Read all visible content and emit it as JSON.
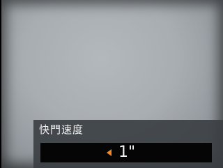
{
  "setting_panel": {
    "label": "快門速度",
    "value": "1\"",
    "accent_color": "#f28a2a",
    "arrow_icon": "arrow-left-icon"
  }
}
